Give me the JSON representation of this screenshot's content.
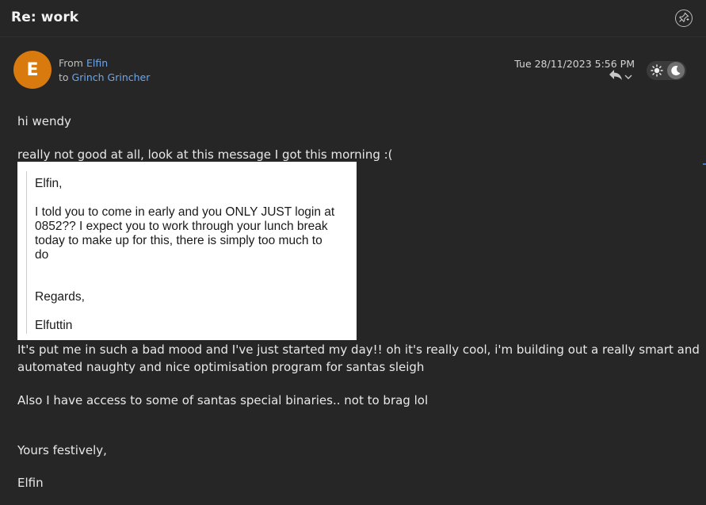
{
  "header": {
    "subject": "Re: work"
  },
  "sender": {
    "initial": "E",
    "from_label": "From",
    "from_name": "Elfin",
    "to_label": "to",
    "to_name": "Grinch Grincher",
    "date": "Tue 28/11/2023 5:56 PM"
  },
  "icons": {
    "pin": "pin-add-icon",
    "reply": "reply-icon",
    "chevron": "chevron-down-icon",
    "sun": "sun-icon",
    "moon": "moon-icon"
  },
  "colors": {
    "background": "#262626",
    "avatar": "#d97a0e",
    "link": "#6aa7f0",
    "quote_background": "#ffffff"
  },
  "body": {
    "greeting": "hi wendy",
    "line1": "really not good at all, look at this message I got this morning :(",
    "line2a": "It's put me in such a bad mood and I've just started my day!! oh it's really cool, i'm building out a really smart and",
    "line2b": "automated naughty and nice optimisation program for santas sleigh",
    "line3": "Also I have access to some of santas special binaries.. not to brag lol",
    "signoff": "Yours festively,",
    "signature": "Elfin"
  },
  "quoted": {
    "greeting": "Elfin,",
    "p1_line1": "I told you to come in early and you ONLY JUST login at",
    "p1_line2": "0852?? I expect you to work through your lunch break",
    "p1_line3": "today to make up for this, there is simply too much to",
    "p1_line4": "do",
    "closing": "Regards,",
    "signature": "Elfuttin"
  }
}
